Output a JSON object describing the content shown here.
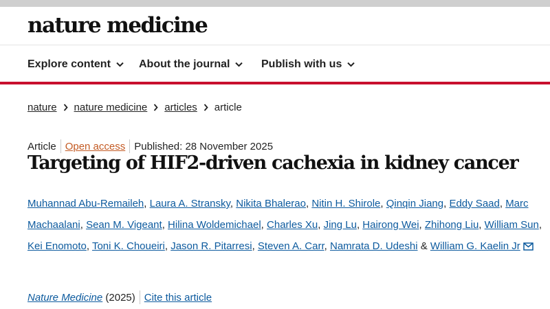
{
  "header": {
    "logo": "nature medicine"
  },
  "nav": {
    "items": [
      {
        "label": "Explore content"
      },
      {
        "label": "About the journal"
      },
      {
        "label": "Publish with us"
      }
    ]
  },
  "breadcrumb": {
    "items": [
      "nature",
      "nature medicine",
      "articles"
    ],
    "current": "article"
  },
  "article": {
    "type": "Article",
    "access": "Open access",
    "published": "Published: 28 November 2025",
    "title": "Targeting of HIF2-driven cachexia in kidney cancer",
    "authors": [
      "Muhannad Abu-Remaileh",
      "Laura A. Stransky",
      "Nikita Bhalerao",
      "Nitin H. Shirole",
      "Qinqin Jiang",
      "Eddy Saad",
      "Marc Machaalani",
      "Sean M. Vigeant",
      "Hilina Woldemichael",
      "Charles Xu",
      "Jing Lu",
      "Hairong Wei",
      "Zhihong Liu",
      "William Sun",
      "Kei Enomoto",
      "Toni K. Choueiri",
      "Jason R. Pitarresi",
      "Steven A. Carr",
      "Namrata D. Udeshi",
      "William G. Kaelin Jr"
    ],
    "last_author_separator": "&",
    "journal": "Nature Medicine",
    "year": "(2025)",
    "cite_label": "Cite this article"
  },
  "colors": {
    "accent_red": "#c8102e",
    "link_blue": "#0c5a9e",
    "open_access_orange": "#c35a23"
  },
  "icons": {
    "nav_chevron": "chevron-down-icon",
    "breadcrumb_separator": "chevron-right-icon",
    "corresponding_author": "envelope-icon"
  }
}
